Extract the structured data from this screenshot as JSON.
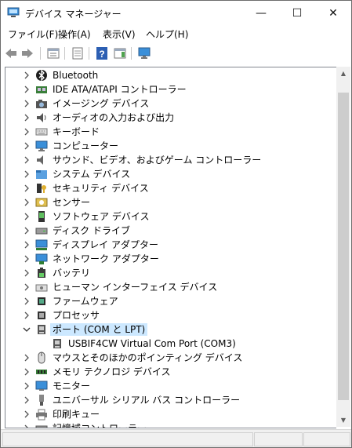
{
  "window": {
    "title": "デバイス マネージャー",
    "minimize_symbol": "—",
    "maximize_symbol": "☐",
    "close_symbol": "✕"
  },
  "menu": [
    {
      "label": "ファイル(F)"
    },
    {
      "label": "操作(A)"
    },
    {
      "label": "表示(V)"
    },
    {
      "label": "ヘルプ(H)"
    }
  ],
  "toolbar": {
    "buttons": [
      "back-icon",
      "forward-icon",
      "properties-view-icon",
      "show-hidden-icon",
      "help-icon",
      "action-pane-icon",
      "monitor-icon"
    ]
  },
  "tree": {
    "items": [
      {
        "label": "Bluetooth",
        "icon": "bluetooth-icon",
        "expanded": false
      },
      {
        "label": "IDE ATA/ATAPI コントローラー",
        "icon": "ide-controller-icon",
        "expanded": false
      },
      {
        "label": "イメージング デバイス",
        "icon": "camera-icon",
        "expanded": false
      },
      {
        "label": "オーディオの入力および出力",
        "icon": "speaker-icon",
        "expanded": false
      },
      {
        "label": "キーボード",
        "icon": "keyboard-icon",
        "expanded": false
      },
      {
        "label": "コンピューター",
        "icon": "computer-icon",
        "expanded": false
      },
      {
        "label": "サウンド、ビデオ、およびゲーム コントローラー",
        "icon": "sound-icon",
        "expanded": false
      },
      {
        "label": "システム デバイス",
        "icon": "system-folder-icon",
        "expanded": false
      },
      {
        "label": "セキュリティ デバイス",
        "icon": "security-key-icon",
        "expanded": false
      },
      {
        "label": "センサー",
        "icon": "sensor-icon",
        "expanded": false
      },
      {
        "label": "ソフトウェア デバイス",
        "icon": "software-device-icon",
        "expanded": false
      },
      {
        "label": "ディスク ドライブ",
        "icon": "disk-drive-icon",
        "expanded": false
      },
      {
        "label": "ディスプレイ アダプター",
        "icon": "display-adapter-icon",
        "expanded": false
      },
      {
        "label": "ネットワーク アダプター",
        "icon": "network-adapter-icon",
        "expanded": false
      },
      {
        "label": "バッテリ",
        "icon": "battery-icon",
        "expanded": false
      },
      {
        "label": "ヒューマン インターフェイス デバイス",
        "icon": "hid-icon",
        "expanded": false
      },
      {
        "label": "ファームウェア",
        "icon": "firmware-chip-icon",
        "expanded": false
      },
      {
        "label": "プロセッサ",
        "icon": "processor-icon",
        "expanded": false
      },
      {
        "label": "ポート (COM と LPT)",
        "icon": "port-icon",
        "expanded": true,
        "selected": true
      },
      {
        "label": "USBIF4CW Virtual Com Port (COM3)",
        "icon": "port-icon",
        "child": true
      },
      {
        "label": "マウスとそのほかのポインティング デバイス",
        "icon": "mouse-icon",
        "expanded": false
      },
      {
        "label": "メモリ テクノロジ デバイス",
        "icon": "memory-icon",
        "expanded": false
      },
      {
        "label": "モニター",
        "icon": "monitor-icon",
        "expanded": false
      },
      {
        "label": "ユニバーサル シリアル バス コントローラー",
        "icon": "usb-icon",
        "expanded": false
      },
      {
        "label": "印刷キュー",
        "icon": "printer-icon",
        "expanded": false
      },
      {
        "label": "記憶域コントローラー",
        "icon": "storage-controller-icon",
        "expanded": false
      }
    ]
  },
  "scrollbar": {
    "up_symbol": "▲",
    "down_symbol": "▼"
  }
}
